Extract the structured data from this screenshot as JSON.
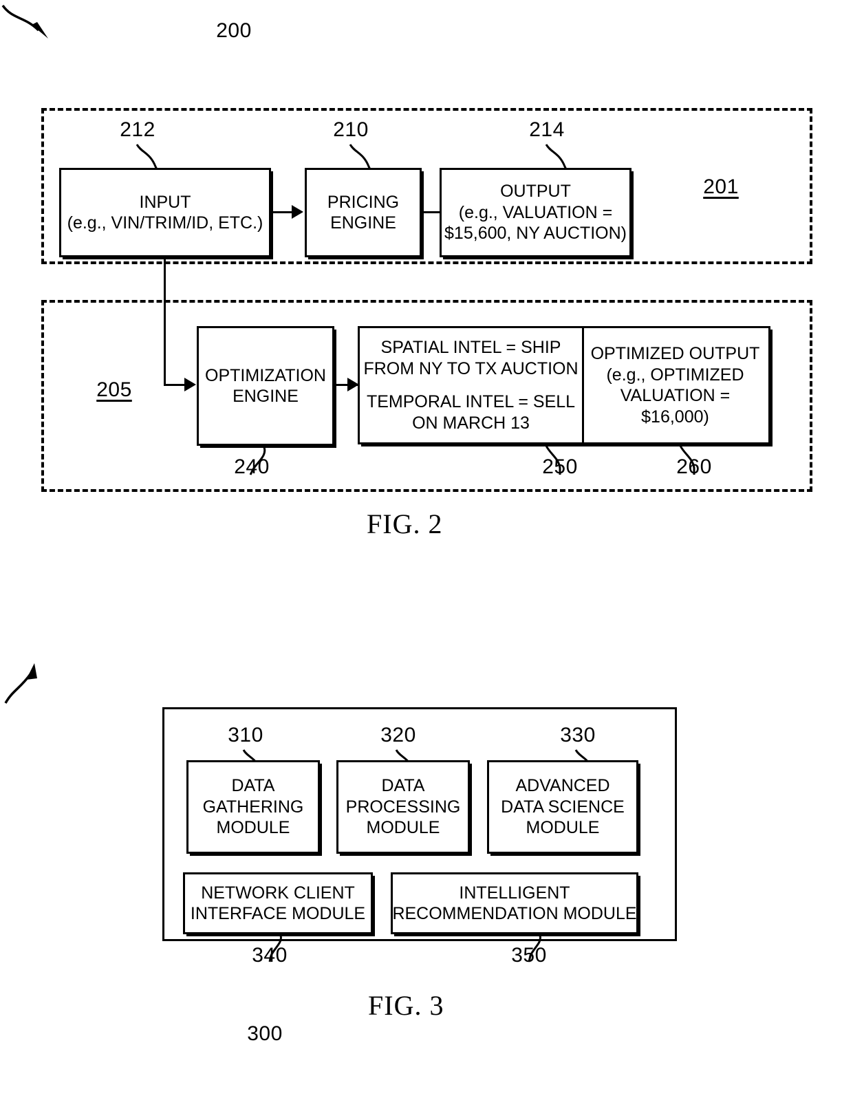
{
  "figure2": {
    "caption": "FIG. 2",
    "ref_overall": "200",
    "group_upper_ref": "201",
    "group_lower_ref": "205",
    "refs": {
      "input": "212",
      "pricing_engine": "210",
      "output": "214",
      "optimization_engine": "240",
      "intel": "250",
      "optimized_output": "260"
    },
    "boxes": {
      "input": {
        "line1": "INPUT",
        "line2": "(e.g., VIN/TRIM/ID, ETC.)"
      },
      "pricing_engine": {
        "line1": "PRICING",
        "line2": "ENGINE"
      },
      "output": {
        "line1": "OUTPUT",
        "line2": "(e.g., VALUATION =",
        "line3": "$15,600, NY AUCTION)"
      },
      "optimization_engine": {
        "line1": "OPTIMIZATION",
        "line2": "ENGINE"
      },
      "intel": {
        "line1": "SPATIAL INTEL = SHIP",
        "line2": "FROM NY TO TX AUCTION",
        "line3": "TEMPORAL INTEL = SELL",
        "line4": "ON MARCH 13"
      },
      "optimized_output": {
        "line1": "OPTIMIZED OUTPUT",
        "line2": "(e.g., OPTIMIZED",
        "line3": "VALUATION =",
        "line4": "$16,000)"
      }
    }
  },
  "figure3": {
    "caption": "FIG. 3",
    "ref_overall": "300",
    "refs": {
      "data_gathering": "310",
      "data_processing": "320",
      "advanced_data_science": "330",
      "network_client_interface": "340",
      "intelligent_recommendation": "350"
    },
    "modules": {
      "data_gathering": {
        "line1": "DATA",
        "line2": "GATHERING",
        "line3": "MODULE"
      },
      "data_processing": {
        "line1": "DATA",
        "line2": "PROCESSING",
        "line3": "MODULE"
      },
      "advanced_data_science": {
        "line1": "ADVANCED",
        "line2": "DATA SCIENCE",
        "line3": "MODULE"
      },
      "network_client_interface": {
        "line1": "NETWORK CLIENT",
        "line2": "INTERFACE MODULE"
      },
      "intelligent_recommendation": {
        "line1": "INTELLIGENT",
        "line2": "RECOMMENDATION MODULE"
      }
    }
  }
}
